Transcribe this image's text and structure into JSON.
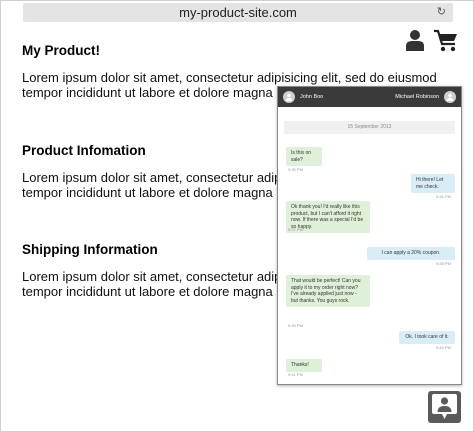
{
  "browser": {
    "url": "my-product-site.com"
  },
  "header": {
    "user_icon": "user-icon",
    "cart_icon": "shopping-cart-icon"
  },
  "sections": [
    {
      "title": "My Product!",
      "lines": [
        "Lorem ipsum dolor sit amet, consectetur adipisicing elit, sed do eiusmod",
        "tempor incididunt ut labore et dolore magna a"
      ]
    },
    {
      "title": "Product Infomation",
      "lines": [
        "Lorem ipsum dolor sit amet, consectetur adipisicing elit",
        "tempor incididunt ut labore et dolore magna a"
      ]
    },
    {
      "title": "Shipping Information",
      "lines": [
        "Lorem ipsum dolor sit amet, consectetur adipisicing elit",
        "tempor incididunt ut labore et dolore magna a"
      ]
    }
  ],
  "chat": {
    "left_name": "John Boo",
    "right_name": "Michael Robinson",
    "date": "15 September 2013",
    "messages": [
      {
        "side": "left",
        "text": "Is this on sale?",
        "time": "9:35 PM"
      },
      {
        "side": "right",
        "text": "Hi there! Let me check.",
        "time": "9:36 PM"
      },
      {
        "side": "left",
        "text": "Ok thank you! I'd really like this product, but I can't afford it right now. If there was a special I'd be so happy.",
        "time": "9:37 PM"
      },
      {
        "side": "right",
        "text": "I can apply a 20% coupon.",
        "time": "9:38 PM"
      },
      {
        "side": "left",
        "text": "That would be perfect! Can you apply it to my order right now? I've already applied just now - but thanks. You guys rock.",
        "time": "9:39 PM"
      },
      {
        "side": "right",
        "text": "Ok. I took care of it.",
        "time": "9:40 PM"
      },
      {
        "side": "left",
        "text": "Thanks!",
        "time": "9:41 PM"
      }
    ]
  },
  "fab": {
    "icon": "chat-user-icon"
  }
}
